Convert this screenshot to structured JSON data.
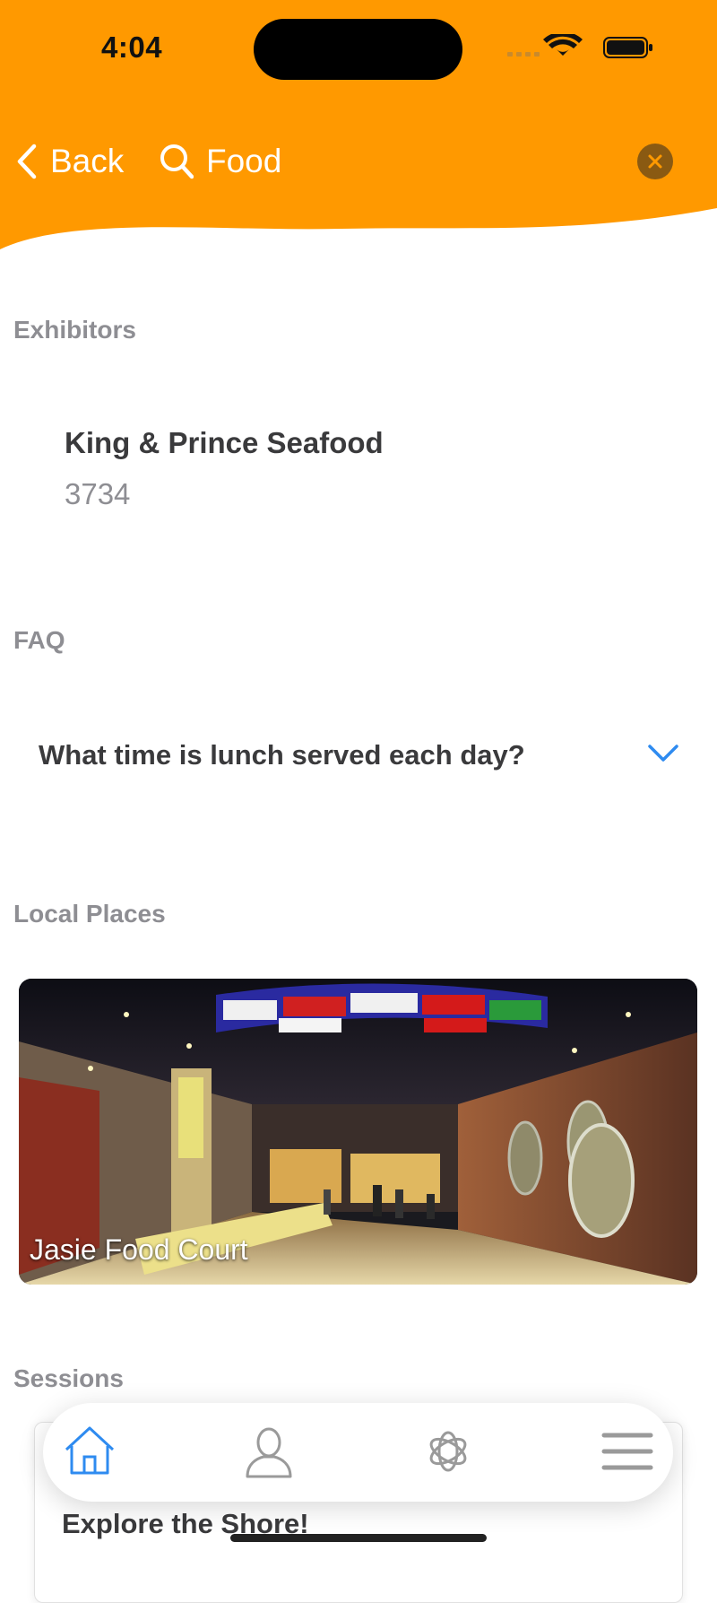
{
  "status_bar": {
    "time": "4:04"
  },
  "nav": {
    "back_label": "Back",
    "search_query": "Food",
    "accent_color": "#FF9900"
  },
  "sections": {
    "exhibitors_title": "Exhibitors",
    "faq_title": "FAQ",
    "local_places_title": "Local Places",
    "sessions_title": "Sessions"
  },
  "exhibitors": [
    {
      "name": "King & Prince Seafood",
      "booth": "3734"
    }
  ],
  "faq": [
    {
      "question": "What time is lunch served each day?"
    }
  ],
  "local_places": [
    {
      "name": "Jasie Food Court"
    }
  ],
  "sessions": [
    {
      "title": "Explore the Shore!"
    }
  ],
  "tabbar": {
    "items": [
      {
        "icon": "home-icon",
        "active": true
      },
      {
        "icon": "profile-icon",
        "active": false
      },
      {
        "icon": "ai-assistant-icon",
        "active": false
      },
      {
        "icon": "menu-icon",
        "active": false
      }
    ],
    "active_color": "#2E8BF0"
  }
}
